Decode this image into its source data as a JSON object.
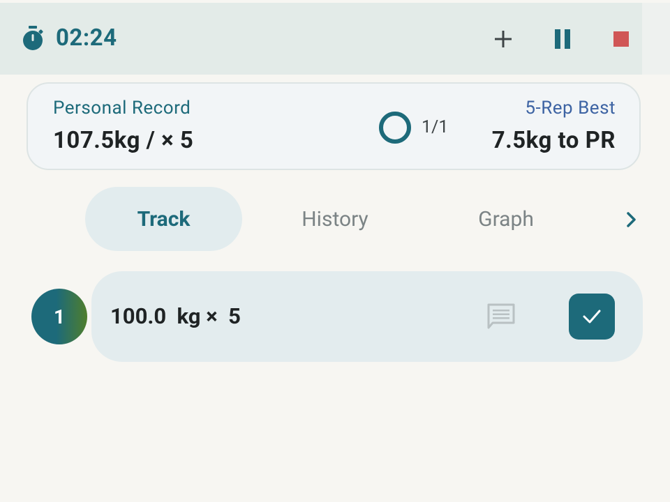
{
  "timer": {
    "elapsed": "02:24"
  },
  "toolbar": {
    "add_icon": "plus-icon",
    "pause_icon": "pause-icon",
    "stop_icon": "stop-icon"
  },
  "record_card": {
    "label": "Personal Record",
    "value": "107.5kg / × 5",
    "progress_text": "1/1",
    "best_label": "5-Rep Best",
    "best_value": "7.5kg to PR"
  },
  "tabs": [
    {
      "label": "Track",
      "active": true
    },
    {
      "label": "History",
      "active": false
    },
    {
      "label": "Graph",
      "active": false
    }
  ],
  "sets": [
    {
      "number": "1",
      "summary": "100.0  kg ×  5",
      "completed": true
    }
  ],
  "colors": {
    "accent": "#1d6a7a",
    "best_label": "#3d63a3",
    "stop": "#d05656",
    "topbar_bg": "#e3ebe8"
  }
}
